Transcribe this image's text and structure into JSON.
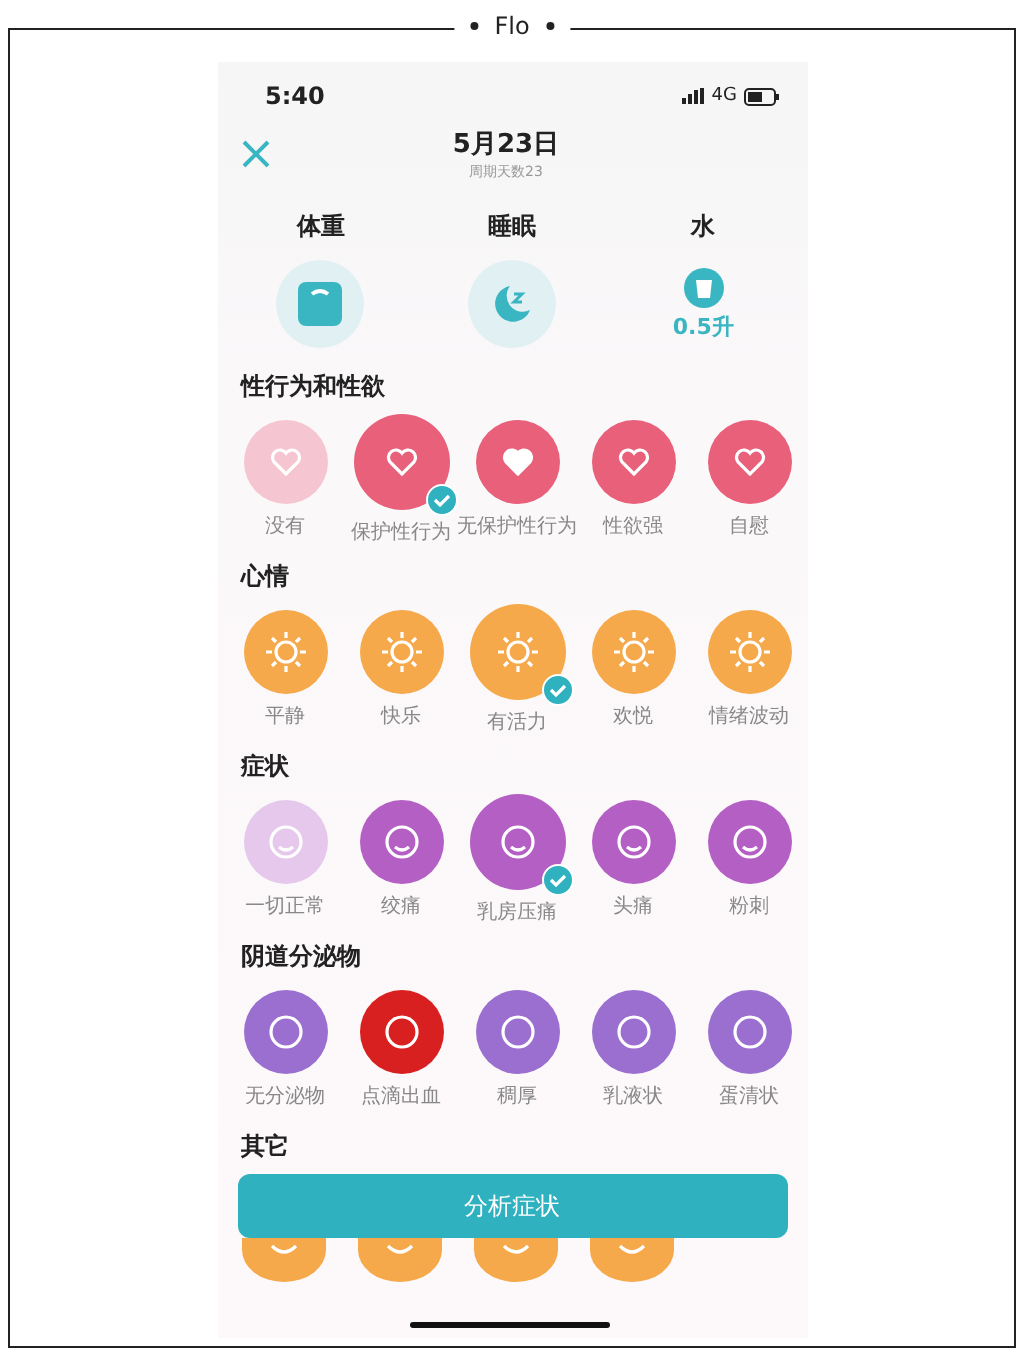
{
  "figure": {
    "title": "Flo"
  },
  "status_bar": {
    "time": "5:40",
    "network": "4G"
  },
  "header": {
    "date": "5月23日",
    "subtitle": "周期天数23"
  },
  "trackers": [
    {
      "label": "体重"
    },
    {
      "label": "睡眠"
    },
    {
      "label": "水",
      "value": "0.5升"
    }
  ],
  "sections": [
    {
      "title": "性行为和性欲",
      "items": [
        {
          "label": "没有",
          "color": "#f5c6d2",
          "selected": false
        },
        {
          "label": "保护性行为",
          "color": "#e8607a",
          "selected": true,
          "faded": false
        },
        {
          "label": "无保护性行为",
          "color": "#e8607a",
          "selected": false,
          "faded": false
        },
        {
          "label": "性欲强",
          "color": "#e8607a",
          "selected": false,
          "faded": false
        },
        {
          "label": "自慰",
          "color": "#e8607a",
          "selected": false,
          "faded": false
        }
      ]
    },
    {
      "title": "心情",
      "items": [
        {
          "label": "平静",
          "color": "#f5a94a",
          "selected": false,
          "faded": false
        },
        {
          "label": "快乐",
          "color": "#f5a94a",
          "selected": false,
          "faded": false
        },
        {
          "label": "有活力",
          "color": "#f5a94a",
          "selected": true,
          "faded": false
        },
        {
          "label": "欢悦",
          "color": "#f5a94a",
          "selected": false,
          "faded": false
        },
        {
          "label": "情绪波动",
          "color": "#f5a94a",
          "selected": false,
          "faded": false
        }
      ]
    },
    {
      "title": "症状",
      "items": [
        {
          "label": "一切正常",
          "color": "#e6c8ec",
          "selected": false
        },
        {
          "label": "绞痛",
          "color": "#b45fc4",
          "selected": false,
          "faded": false
        },
        {
          "label": "乳房压痛",
          "color": "#b45fc4",
          "selected": true,
          "faded": false
        },
        {
          "label": "头痛",
          "color": "#b45fc4",
          "selected": false,
          "faded": false
        },
        {
          "label": "粉刺",
          "color": "#b45fc4",
          "selected": false,
          "faded": false
        }
      ]
    },
    {
      "title": "阴道分泌物",
      "items": [
        {
          "label": "无分泌物",
          "color": "#9a6fd0",
          "selected": false,
          "faded": false
        },
        {
          "label": "点滴出血",
          "color": "#d92020",
          "selected": false,
          "faded": false
        },
        {
          "label": "稠厚",
          "color": "#9a6fd0",
          "selected": false,
          "faded": false
        },
        {
          "label": "乳液状",
          "color": "#9a6fd0",
          "selected": false,
          "faded": false
        },
        {
          "label": "蛋清状",
          "color": "#9a6fd0",
          "selected": false,
          "faded": false
        }
      ]
    },
    {
      "title": "其它",
      "items": [
        {
          "color": "#f5a94a",
          "selected": false,
          "faded": false
        },
        {
          "color": "#f5a94a",
          "selected": false,
          "faded": false
        },
        {
          "color": "#f5a94a",
          "selected": false,
          "faded": false
        },
        {
          "color": "#f5a94a",
          "selected": false,
          "faded": false
        }
      ]
    }
  ],
  "action_button": {
    "label": "分析症状"
  }
}
